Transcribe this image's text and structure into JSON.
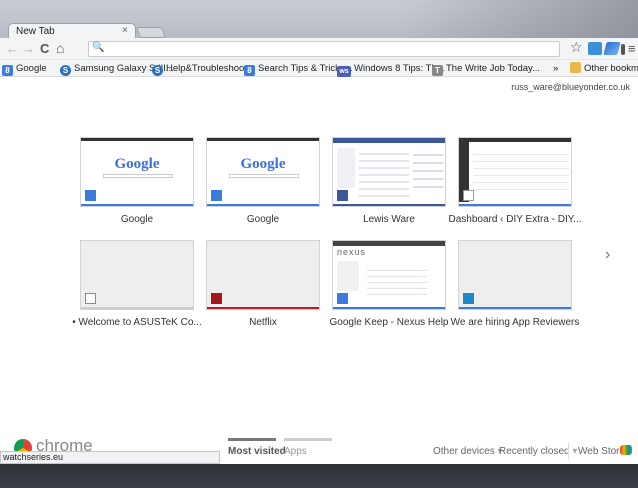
{
  "tab": {
    "title": "New Tab",
    "close_glyph": "×"
  },
  "toolbar": {
    "back_icon": "←",
    "forward_icon": "→",
    "reload_icon": "C",
    "home_icon": "⌂",
    "search_icon": "🔍",
    "star_icon": "☆",
    "menu_icon": "≡"
  },
  "bookmarks": [
    {
      "label": "Google",
      "icon_text": "8",
      "color": "#3b7bdc"
    },
    {
      "label": "Samsung Galaxy S III...",
      "icon_text": "S",
      "color": "#2c6fba"
    },
    {
      "label": "Help&Troubleshoot...",
      "icon_text": "S",
      "color": "#2c6fba"
    },
    {
      "label": "Search Tips & Tricks...",
      "icon_text": "8",
      "color": "#3b7bdc"
    },
    {
      "label": "Windows 8 Tips: Th...",
      "icon_text": "ws",
      "color": "#4a60b8"
    },
    {
      "label": "The Write Job Today...",
      "icon_text": "T",
      "color": "#888888"
    }
  ],
  "bookmarks_more": "»",
  "other_bookmarks": "Other bookmarks",
  "user_email": "russ_ware@blueyonder.co.uk",
  "tiles": [
    {
      "title": "Google",
      "kind": "google",
      "bar_color": "#3b7bdc"
    },
    {
      "title": "Google",
      "kind": "google",
      "bar_color": "#3b7bdc"
    },
    {
      "title": "Lewis Ware",
      "kind": "facebook",
      "bar_color": "#3b5998"
    },
    {
      "title": "Dashboard ‹ DIY Extra - DIY...",
      "kind": "dashboard",
      "bar_color": "#3b7bdc"
    },
    {
      "title": "• Welcome to ASUSTeK Co...",
      "kind": "empty",
      "bar_color": "#cccccc"
    },
    {
      "title": "Netflix",
      "kind": "empty",
      "bar_color": "#c4171f"
    },
    {
      "title": "Google Keep - Nexus Help",
      "kind": "nexus",
      "bar_color": "#3b7bdc"
    },
    {
      "title": "We are hiring App Reviewers",
      "kind": "empty",
      "bar_color": "#3b7bdc"
    }
  ],
  "google_logo": "Google",
  "nexus_logo": "nexus",
  "next_arrow": "›",
  "footer": {
    "brand": "chrome",
    "most_visited": "Most visited",
    "apps": "Apps",
    "other_devices": "Other devices",
    "recently_closed": "Recently closed",
    "web_store": "Web Store"
  },
  "status_url": "watchseries.eu"
}
